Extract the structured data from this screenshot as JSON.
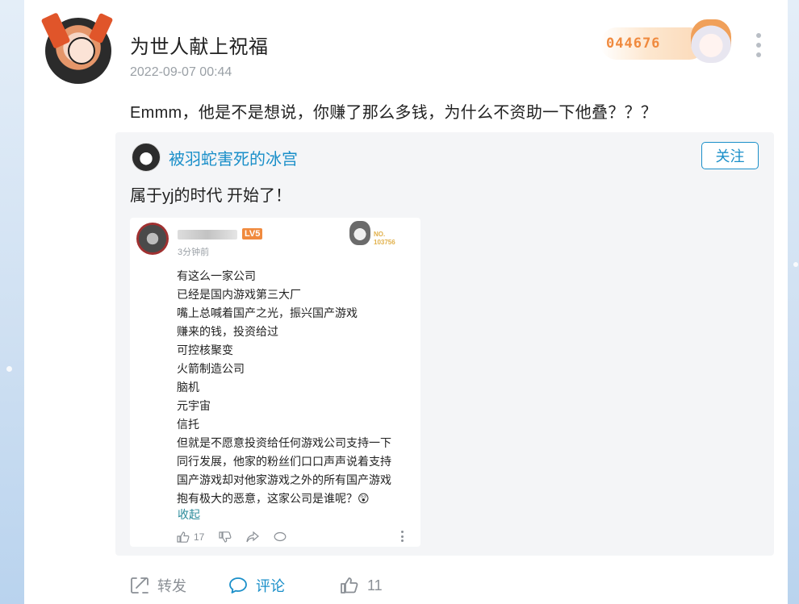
{
  "post": {
    "username": "为世人献上祝福",
    "timestamp": "2022-09-07 00:44",
    "fan_badge_number": "044676",
    "text": "Emmm，他是不是想说，你赚了那么多钱，为什么不资助一下他叠？？？",
    "icons": {
      "avatar": "user-avatar",
      "fan_badge": "fan-badge-icon",
      "more": "more-vertical-icon"
    }
  },
  "quote": {
    "username": "被羽蛇害死的冰宫",
    "follow_label": "关注",
    "text": "属于yj的时代 开始了！",
    "screenshot": {
      "level": "LV5",
      "time": "3分钟前",
      "badge_no": "NO.",
      "badge_number": "103756",
      "lines": [
        "有这么一家公司",
        "已经是国内游戏第三大厂",
        "嘴上总喊着国产之光，振兴国产游戏",
        "赚来的钱，投资给过",
        "可控核聚变",
        "火箭制造公司",
        "脑机",
        "元宇宙",
        "信托",
        "但就是不愿意投资给任何游戏公司支持一下",
        "同行发展，他家的粉丝们口口声声说着支持",
        "国产游戏却对他家游戏之外的所有国产游戏",
        "抱有极大的恶意，这家公司是谁呢？😲"
      ],
      "collapse_label": "收起",
      "like_count": "17"
    }
  },
  "footer": {
    "repost_label": "转发",
    "comment_label": "评论",
    "like_count": "11"
  },
  "colors": {
    "accent": "#1a8fc9",
    "badge_orange": "#f08a3e",
    "text": "#222222",
    "muted": "#9aa0a6",
    "quote_bg": "#f4f5f7"
  }
}
